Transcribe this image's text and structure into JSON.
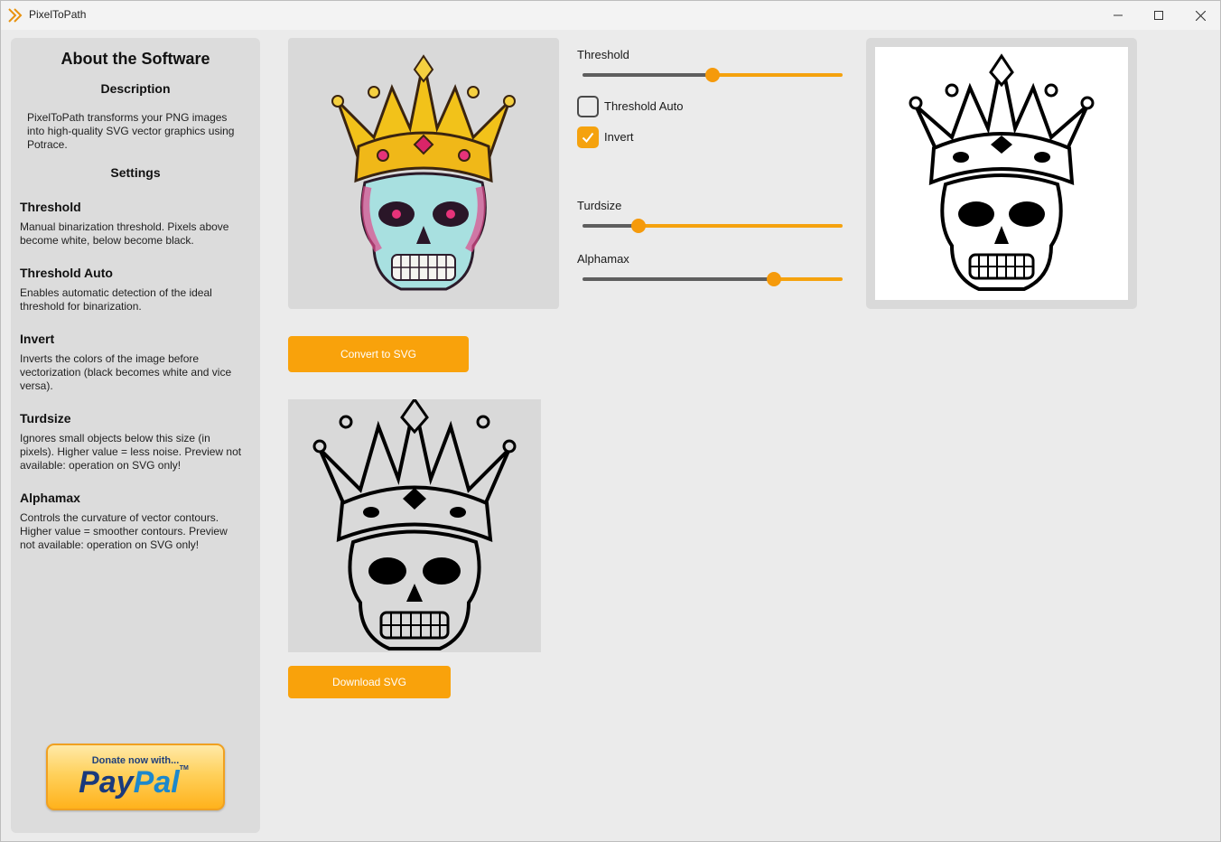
{
  "window": {
    "title": "PixelToPath",
    "accent_color": "#f9a20b"
  },
  "sidebar": {
    "title": "About the Software",
    "description_heading": "Description",
    "description_lines": [
      "PixelToPath transforms your PNG images",
      "into high-quality SVG vector graphics using",
      "Potrace."
    ],
    "settings_heading": "Settings",
    "sections": [
      {
        "heading": "Threshold",
        "lines": [
          "Manual binarization threshold. Pixels above",
          "become white, below become black."
        ]
      },
      {
        "heading": "Threshold Auto",
        "lines": [
          "Enables automatic detection of the ideal",
          "threshold for binarization."
        ]
      },
      {
        "heading": "Invert",
        "lines": [
          "Inverts the colors of the image before",
          "vectorization (black becomes white and vice",
          "versa)."
        ]
      },
      {
        "heading": "Turdsize",
        "lines": [
          "Ignores small objects below this size (in",
          "pixels). Higher value = less noise. Preview not",
          "available: operation on SVG only!"
        ]
      },
      {
        "heading": "Alphamax",
        "lines": [
          "Controls the curvature of vector contours.",
          "Higher value = smoother contours. Preview",
          "not available: operation on SVG only!"
        ]
      }
    ],
    "donate": {
      "top_text": "Donate now with...",
      "logo_pay": "Pay",
      "logo_pal": "Pal",
      "logo_tm": "TM"
    }
  },
  "controls": {
    "threshold": {
      "label": "Threshold",
      "value_fraction": 0.5
    },
    "threshold_auto": {
      "label": "Threshold Auto",
      "checked": false
    },
    "invert": {
      "label": "Invert",
      "checked": true
    },
    "turdsize": {
      "label": "Turdsize",
      "value_fraction": 0.2
    },
    "alphamax": {
      "label": "Alphamax",
      "value_fraction": 0.75
    }
  },
  "buttons": {
    "convert": "Convert to SVG",
    "download": "Download SVG"
  },
  "icons": {
    "app": "double-chevron-icon",
    "minimize": "minimize-icon",
    "maximize": "maximize-icon",
    "close": "close-icon",
    "check": "checkmark-icon"
  }
}
